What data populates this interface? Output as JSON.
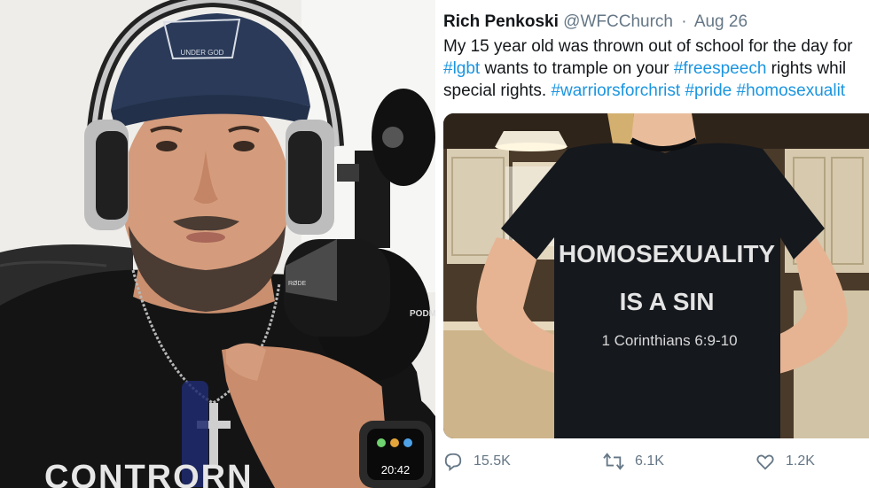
{
  "tweet": {
    "author_name": "Rich Penkoski",
    "handle": "@WFCChurch",
    "separator": "·",
    "date": "Aug 26",
    "line1": "My 15 year old was thrown out of school for the day for",
    "line2": [
      {
        "t": "#lgbt",
        "tag": true
      },
      {
        "t": " wants to trample on your ",
        "tag": false
      },
      {
        "t": "#freespeech",
        "tag": true
      },
      {
        "t": " rights whil",
        "tag": false
      }
    ],
    "line3": [
      {
        "t": "special rights. ",
        "tag": false
      },
      {
        "t": "#warriorsforchrist",
        "tag": true
      },
      {
        "t": " ",
        "tag": false
      },
      {
        "t": "#pride",
        "tag": true
      },
      {
        "t": " ",
        "tag": false
      },
      {
        "t": "#homosexualit",
        "tag": true
      }
    ],
    "shirt_line1": "HOMOSEXUALITY",
    "shirt_line2": "IS A SIN",
    "shirt_line3": "1 Corinthians 6:9-10",
    "replies": "15.5K",
    "retweets": "6.1K",
    "likes": "1.2K"
  },
  "photo": {
    "cap_logo_text": "UNDER GOD",
    "shirt_text": "CONTRORN",
    "watch_time": "20:42",
    "mic_label": "PODM",
    "mic_brand": "RØDE"
  },
  "colors": {
    "hashtag": "#1b95e0",
    "muted": "#657786",
    "text": "#14171a",
    "cap": "#2a3a58"
  }
}
